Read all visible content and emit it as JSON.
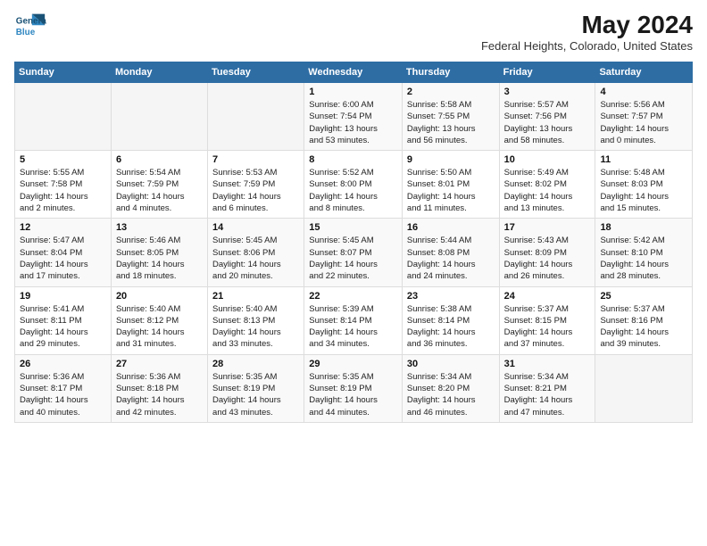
{
  "logo": {
    "line1": "General",
    "line2": "Blue"
  },
  "title": "May 2024",
  "subtitle": "Federal Heights, Colorado, United States",
  "days_of_week": [
    "Sunday",
    "Monday",
    "Tuesday",
    "Wednesday",
    "Thursday",
    "Friday",
    "Saturday"
  ],
  "weeks": [
    [
      {
        "day": "",
        "info": ""
      },
      {
        "day": "",
        "info": ""
      },
      {
        "day": "",
        "info": ""
      },
      {
        "day": "1",
        "info": "Sunrise: 6:00 AM\nSunset: 7:54 PM\nDaylight: 13 hours\nand 53 minutes."
      },
      {
        "day": "2",
        "info": "Sunrise: 5:58 AM\nSunset: 7:55 PM\nDaylight: 13 hours\nand 56 minutes."
      },
      {
        "day": "3",
        "info": "Sunrise: 5:57 AM\nSunset: 7:56 PM\nDaylight: 13 hours\nand 58 minutes."
      },
      {
        "day": "4",
        "info": "Sunrise: 5:56 AM\nSunset: 7:57 PM\nDaylight: 14 hours\nand 0 minutes."
      }
    ],
    [
      {
        "day": "5",
        "info": "Sunrise: 5:55 AM\nSunset: 7:58 PM\nDaylight: 14 hours\nand 2 minutes."
      },
      {
        "day": "6",
        "info": "Sunrise: 5:54 AM\nSunset: 7:59 PM\nDaylight: 14 hours\nand 4 minutes."
      },
      {
        "day": "7",
        "info": "Sunrise: 5:53 AM\nSunset: 7:59 PM\nDaylight: 14 hours\nand 6 minutes."
      },
      {
        "day": "8",
        "info": "Sunrise: 5:52 AM\nSunset: 8:00 PM\nDaylight: 14 hours\nand 8 minutes."
      },
      {
        "day": "9",
        "info": "Sunrise: 5:50 AM\nSunset: 8:01 PM\nDaylight: 14 hours\nand 11 minutes."
      },
      {
        "day": "10",
        "info": "Sunrise: 5:49 AM\nSunset: 8:02 PM\nDaylight: 14 hours\nand 13 minutes."
      },
      {
        "day": "11",
        "info": "Sunrise: 5:48 AM\nSunset: 8:03 PM\nDaylight: 14 hours\nand 15 minutes."
      }
    ],
    [
      {
        "day": "12",
        "info": "Sunrise: 5:47 AM\nSunset: 8:04 PM\nDaylight: 14 hours\nand 17 minutes."
      },
      {
        "day": "13",
        "info": "Sunrise: 5:46 AM\nSunset: 8:05 PM\nDaylight: 14 hours\nand 18 minutes."
      },
      {
        "day": "14",
        "info": "Sunrise: 5:45 AM\nSunset: 8:06 PM\nDaylight: 14 hours\nand 20 minutes."
      },
      {
        "day": "15",
        "info": "Sunrise: 5:45 AM\nSunset: 8:07 PM\nDaylight: 14 hours\nand 22 minutes."
      },
      {
        "day": "16",
        "info": "Sunrise: 5:44 AM\nSunset: 8:08 PM\nDaylight: 14 hours\nand 24 minutes."
      },
      {
        "day": "17",
        "info": "Sunrise: 5:43 AM\nSunset: 8:09 PM\nDaylight: 14 hours\nand 26 minutes."
      },
      {
        "day": "18",
        "info": "Sunrise: 5:42 AM\nSunset: 8:10 PM\nDaylight: 14 hours\nand 28 minutes."
      }
    ],
    [
      {
        "day": "19",
        "info": "Sunrise: 5:41 AM\nSunset: 8:11 PM\nDaylight: 14 hours\nand 29 minutes."
      },
      {
        "day": "20",
        "info": "Sunrise: 5:40 AM\nSunset: 8:12 PM\nDaylight: 14 hours\nand 31 minutes."
      },
      {
        "day": "21",
        "info": "Sunrise: 5:40 AM\nSunset: 8:13 PM\nDaylight: 14 hours\nand 33 minutes."
      },
      {
        "day": "22",
        "info": "Sunrise: 5:39 AM\nSunset: 8:14 PM\nDaylight: 14 hours\nand 34 minutes."
      },
      {
        "day": "23",
        "info": "Sunrise: 5:38 AM\nSunset: 8:14 PM\nDaylight: 14 hours\nand 36 minutes."
      },
      {
        "day": "24",
        "info": "Sunrise: 5:37 AM\nSunset: 8:15 PM\nDaylight: 14 hours\nand 37 minutes."
      },
      {
        "day": "25",
        "info": "Sunrise: 5:37 AM\nSunset: 8:16 PM\nDaylight: 14 hours\nand 39 minutes."
      }
    ],
    [
      {
        "day": "26",
        "info": "Sunrise: 5:36 AM\nSunset: 8:17 PM\nDaylight: 14 hours\nand 40 minutes."
      },
      {
        "day": "27",
        "info": "Sunrise: 5:36 AM\nSunset: 8:18 PM\nDaylight: 14 hours\nand 42 minutes."
      },
      {
        "day": "28",
        "info": "Sunrise: 5:35 AM\nSunset: 8:19 PM\nDaylight: 14 hours\nand 43 minutes."
      },
      {
        "day": "29",
        "info": "Sunrise: 5:35 AM\nSunset: 8:19 PM\nDaylight: 14 hours\nand 44 minutes."
      },
      {
        "day": "30",
        "info": "Sunrise: 5:34 AM\nSunset: 8:20 PM\nDaylight: 14 hours\nand 46 minutes."
      },
      {
        "day": "31",
        "info": "Sunrise: 5:34 AM\nSunset: 8:21 PM\nDaylight: 14 hours\nand 47 minutes."
      },
      {
        "day": "",
        "info": ""
      }
    ]
  ]
}
